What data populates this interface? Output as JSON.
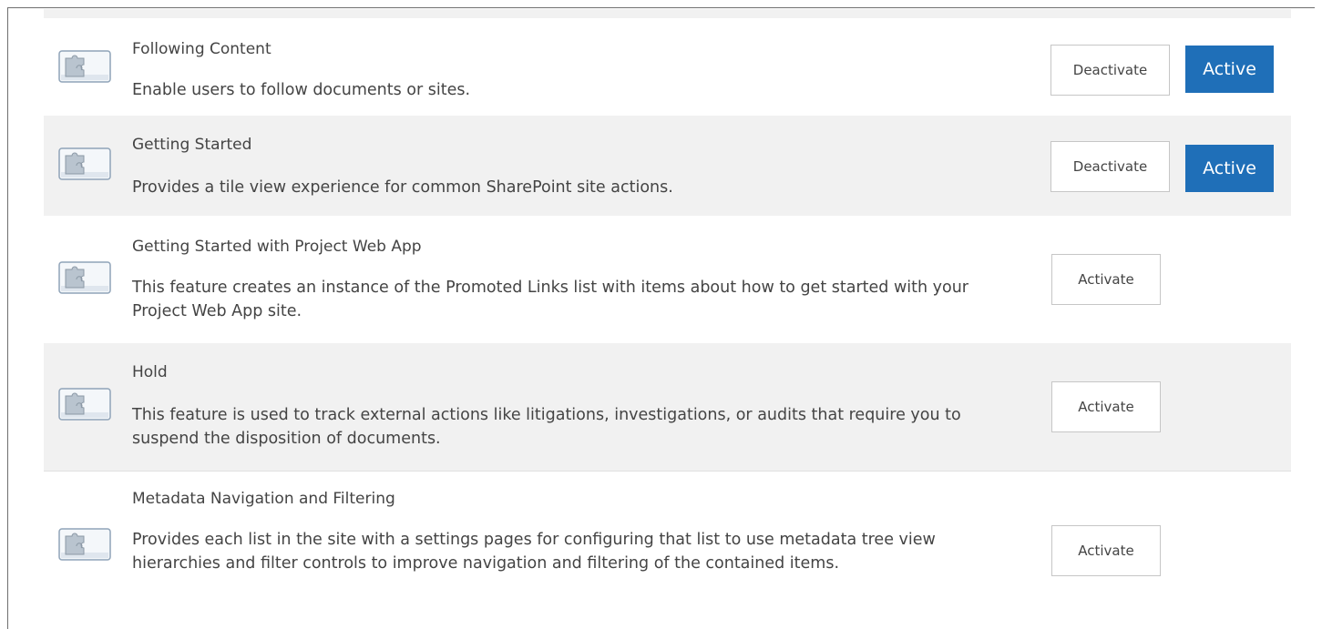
{
  "features": [
    {
      "title": "Following Content",
      "description": "Enable users to follow documents or sites.",
      "action_label": "Deactivate",
      "status_label": "Active"
    },
    {
      "title": "Getting Started",
      "description": "Provides a tile view experience for common SharePoint site actions.",
      "action_label": "Deactivate",
      "status_label": "Active"
    },
    {
      "title": "Getting Started with Project Web App",
      "description": "This feature creates an instance of the Promoted Links list with items about how to get started with your Project Web App site.",
      "action_label": "Activate"
    },
    {
      "title": "Hold",
      "description": "This feature is used to track external actions like litigations, investigations, or audits that require you to suspend the disposition of documents.",
      "action_label": "Activate"
    },
    {
      "title": "Metadata Navigation and Filtering",
      "description": "Provides each list in the site with a settings pages for configuring that list to use metadata tree view hierarchies and filter controls to improve navigation and filtering of the contained items.",
      "action_label": "Activate"
    }
  ],
  "icon": "puzzle-piece-icon",
  "colors": {
    "active_button": "#1f6fb8",
    "alt_row_background": "#f1f1f1"
  }
}
